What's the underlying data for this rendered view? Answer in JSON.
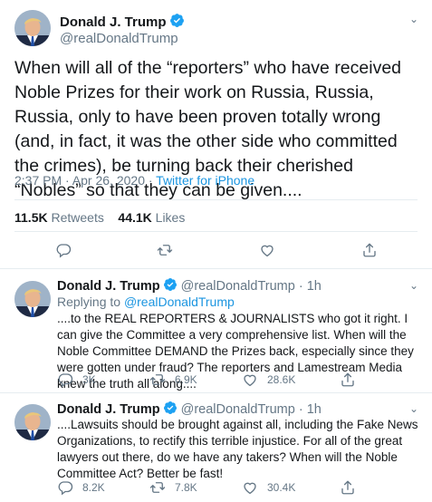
{
  "main_tweet": {
    "display_name": "Donald J. Trump",
    "handle": "@realDonaldTrump",
    "text": "When will all of the “reporters” who have received Noble Prizes for their work on Russia, Russia, Russia, only to have been proven totally wrong (and, in fact, it was the other side who committed the crimes), be turning back their cherished “Nobles” so that they can be given....",
    "time": "2:37 PM · Apr 26, 2020 · ",
    "source": "Twitter for iPhone",
    "retweets_count": "11.5K",
    "retweets_label": "Retweets",
    "likes_count": "44.1K",
    "likes_label": "Likes"
  },
  "replies": [
    {
      "display_name": "Donald J. Trump",
      "handle": "@realDonaldTrump · 1h",
      "replying_prefix": "Replying to ",
      "replying_to": "@realDonaldTrump",
      "text": "....to the REAL REPORTERS & JOURNALISTS who got it right. I can give the Committee a very comprehensive list. When will the Noble Committee DEMAND the Prizes back, especially since they were gotten under fraud? The reporters and Lamestream Media knew the truth all along....",
      "reply_count": "3K",
      "retweet_count": "6.9K",
      "like_count": "28.6K"
    },
    {
      "display_name": "Donald J. Trump",
      "handle": "@realDonaldTrump · 1h",
      "text": "....Lawsuits should be brought against all, including the Fake News Organizations, to rectify this terrible injustice. For all of the great lawyers out there, do we have any takers? When will the Noble Committee Act? Better be fast!",
      "reply_count": "8.2K",
      "retweet_count": "7.8K",
      "like_count": "30.4K"
    }
  ],
  "icons": {
    "verified": "verified-badge-icon",
    "reply": "reply-icon",
    "retweet": "retweet-icon",
    "like": "heart-icon",
    "share": "share-icon",
    "more": "chevron-down-icon"
  },
  "colors": {
    "accent": "#1b95e0",
    "verified": "#1da1f2",
    "muted": "#657786",
    "border": "#e6ecf0"
  }
}
